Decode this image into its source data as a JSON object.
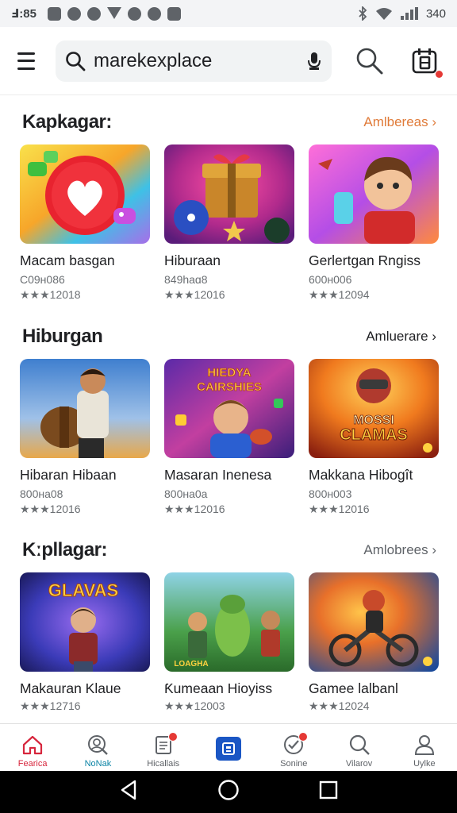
{
  "status_bar": {
    "time": "Ⅎ:85",
    "battery": "340"
  },
  "header": {
    "search_value": "marekexplace",
    "icons": [
      "menu-icon",
      "search-icon",
      "mic-icon",
      "search-icon",
      "calendar-icon"
    ]
  },
  "sections": [
    {
      "title": "Kapkagar:",
      "more": "Amlbereas ›",
      "more_color": "#e07b39",
      "cards": [
        {
          "title": "Macam basgan",
          "sub": "C09ʜ086",
          "rating": "★★★12018"
        },
        {
          "title": "Hiburaan",
          "sub": "849haɑ8",
          "rating": "★★★12016"
        },
        {
          "title": "Gerlertgan Rngiss",
          "sub": "600ʜ006",
          "rating": "★★★12094"
        }
      ]
    },
    {
      "title": "Hiburgan",
      "more": "Amluerare ›",
      "more_color": "#202124",
      "cards": [
        {
          "title": "Hibaran Hibaan",
          "sub": "800ʜa08",
          "rating": "★★★12016"
        },
        {
          "title": "Masaran Inenesa",
          "sub": "800ʜa0a",
          "rating": "★★★12016"
        },
        {
          "title": "Makkana Hibogît",
          "sub": "800ʜ003",
          "rating": "★★★12016"
        }
      ]
    },
    {
      "title": "Kːpllagar:",
      "more": "Amlobrees ›",
      "more_color": "#5f6368",
      "cards": [
        {
          "title": "Makauran Klaue",
          "sub": "",
          "rating": "★★★12716"
        },
        {
          "title": "Ƙumeaan Hioyiss",
          "sub": "",
          "rating": "★★★12003"
        },
        {
          "title": "Gamee lalbanl",
          "sub": "",
          "rating": "★★★12024"
        }
      ]
    }
  ],
  "thumb_texts": {
    "s2c2": "HIEDYA",
    "s2c2b": "CAIRSHIES",
    "s2c3": "MOSSI",
    "s2c3b": "CLAMAS",
    "s3c1": "GLAVAS",
    "s3c2": "LOAGHA"
  },
  "bottom_nav": [
    {
      "label": "Fearica",
      "icon": "home-icon"
    },
    {
      "label": "NoNak",
      "icon": "profile-search-icon"
    },
    {
      "label": "Hicallais",
      "icon": "document-icon"
    },
    {
      "label": "",
      "icon": "apps-icon"
    },
    {
      "label": "Sonine",
      "icon": "checkmark-icon"
    },
    {
      "label": "Vilarov",
      "icon": "search-icon"
    },
    {
      "label": "Uylke",
      "icon": "person-icon"
    }
  ],
  "colors": {
    "accent_red": "#d7263d",
    "accent_blue": "#1a56c4",
    "badge_red": "#e53935"
  }
}
